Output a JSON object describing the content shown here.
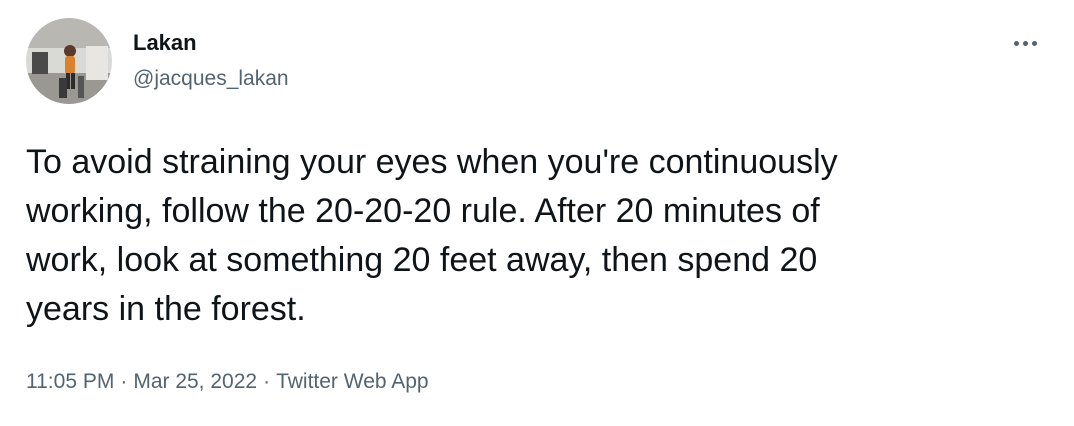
{
  "user": {
    "display_name": "Lakan",
    "handle": "@jacques_lakan",
    "avatar_icon": "profile-photo-avatar"
  },
  "tweet": {
    "text": "To avoid straining your eyes when you're continuously\nworking, follow the 20-20-20 rule. After 20 minutes of\nwork, look at something 20 feet away, then spend 20\nyears in the forest."
  },
  "meta": {
    "time": "11:05 PM",
    "date": "Mar 25, 2022",
    "separator": "·",
    "source": "Twitter Web App"
  },
  "colors": {
    "text_primary": "#0f1419",
    "text_secondary": "#536471",
    "background": "#ffffff"
  },
  "icons": {
    "more": "more-horizontal-icon"
  }
}
